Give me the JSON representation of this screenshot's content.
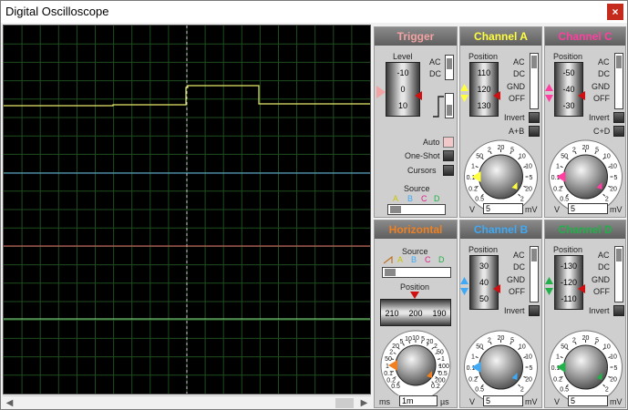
{
  "window": {
    "title": "Digital Oscilloscope",
    "close": "×"
  },
  "traces": {
    "a_color": "#e8e86a",
    "b_color": "#6ab4e8",
    "c_color": "#e86a6a",
    "d_color": "#8ae88a"
  },
  "colors": {
    "trigger_title": "#f3a3a3",
    "channel_a": "#ffff40",
    "channel_b": "#3fa9f5",
    "channel_c": "#ff3fa0",
    "channel_d": "#23b04a",
    "horizontal": "#f08020"
  },
  "trigger": {
    "title": "Trigger",
    "level_label": "Level",
    "level_ticks": [
      "-10",
      "0",
      "10"
    ],
    "ac": "AC",
    "dc": "DC",
    "auto": "Auto",
    "one_shot": "One-Shot",
    "cursors": "Cursors",
    "source_label": "Source",
    "source_letters": [
      "A",
      "B",
      "C",
      "D"
    ]
  },
  "channel_a": {
    "title": "Channel A",
    "position_label": "Position",
    "ticks": [
      "110",
      "120",
      "130"
    ],
    "ac": "AC",
    "dc": "DC",
    "gnd": "GND",
    "off": "OFF",
    "invert": "Invert",
    "combine": "A+B",
    "dial_left": "V",
    "dial_right": "mV",
    "dial_value": "5",
    "dial_scale": [
      "0.5",
      "0.2",
      "0.1",
      "1",
      "50",
      "2",
      "20",
      "5",
      "10",
      "10",
      "5",
      "20",
      "2"
    ]
  },
  "channel_b": {
    "title": "Channel B",
    "position_label": "Position",
    "ticks": [
      "30",
      "40",
      "50"
    ],
    "ac": "AC",
    "dc": "DC",
    "gnd": "GND",
    "off": "OFF",
    "invert": "Invert",
    "dial_left": "V",
    "dial_right": "mV",
    "dial_value": "5"
  },
  "channel_c": {
    "title": "Channel C",
    "position_label": "Position",
    "ticks": [
      "-50",
      "-40",
      "-30"
    ],
    "ac": "AC",
    "dc": "DC",
    "gnd": "GND",
    "off": "OFF",
    "invert": "Invert",
    "combine": "C+D",
    "dial_left": "V",
    "dial_right": "mV",
    "dial_value": "5"
  },
  "channel_d": {
    "title": "Channel D",
    "position_label": "Position",
    "ticks": [
      "-130",
      "-120",
      "-110"
    ],
    "ac": "AC",
    "dc": "DC",
    "gnd": "GND",
    "off": "OFF",
    "invert": "Invert",
    "dial_left": "V",
    "dial_right": "mV",
    "dial_value": "5"
  },
  "horizontal": {
    "title": "Horizontal",
    "source_label": "Source",
    "source_letters": [
      "A",
      "B",
      "C",
      "D"
    ],
    "position_label": "Position",
    "position_ticks": [
      "210",
      "200",
      "190"
    ],
    "dial_left": "ms",
    "dial_right": "µs",
    "dial_value": "1m",
    "dial_scale": [
      "0.5",
      "0.2",
      "0.1",
      "1",
      "50",
      "2",
      "20",
      "5",
      "10",
      "10",
      "5",
      "20",
      "2",
      "50",
      "1",
      "100",
      "0.5",
      "200",
      "0.2"
    ]
  }
}
